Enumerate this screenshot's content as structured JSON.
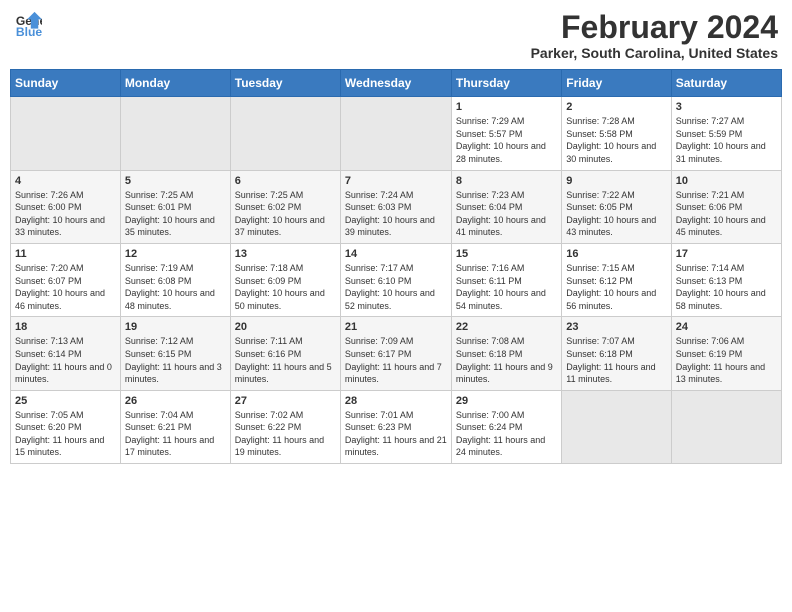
{
  "header": {
    "logo_line1": "General",
    "logo_line2": "Blue",
    "title": "February 2024",
    "subtitle": "Parker, South Carolina, United States"
  },
  "weekdays": [
    "Sunday",
    "Monday",
    "Tuesday",
    "Wednesday",
    "Thursday",
    "Friday",
    "Saturday"
  ],
  "weeks": [
    [
      {
        "day": "",
        "sunrise": "",
        "sunset": "",
        "daylight": "",
        "empty": true
      },
      {
        "day": "",
        "sunrise": "",
        "sunset": "",
        "daylight": "",
        "empty": true
      },
      {
        "day": "",
        "sunrise": "",
        "sunset": "",
        "daylight": "",
        "empty": true
      },
      {
        "day": "",
        "sunrise": "",
        "sunset": "",
        "daylight": "",
        "empty": true
      },
      {
        "day": "1",
        "sunrise": "Sunrise: 7:29 AM",
        "sunset": "Sunset: 5:57 PM",
        "daylight": "Daylight: 10 hours and 28 minutes."
      },
      {
        "day": "2",
        "sunrise": "Sunrise: 7:28 AM",
        "sunset": "Sunset: 5:58 PM",
        "daylight": "Daylight: 10 hours and 30 minutes."
      },
      {
        "day": "3",
        "sunrise": "Sunrise: 7:27 AM",
        "sunset": "Sunset: 5:59 PM",
        "daylight": "Daylight: 10 hours and 31 minutes."
      }
    ],
    [
      {
        "day": "4",
        "sunrise": "Sunrise: 7:26 AM",
        "sunset": "Sunset: 6:00 PM",
        "daylight": "Daylight: 10 hours and 33 minutes."
      },
      {
        "day": "5",
        "sunrise": "Sunrise: 7:25 AM",
        "sunset": "Sunset: 6:01 PM",
        "daylight": "Daylight: 10 hours and 35 minutes."
      },
      {
        "day": "6",
        "sunrise": "Sunrise: 7:25 AM",
        "sunset": "Sunset: 6:02 PM",
        "daylight": "Daylight: 10 hours and 37 minutes."
      },
      {
        "day": "7",
        "sunrise": "Sunrise: 7:24 AM",
        "sunset": "Sunset: 6:03 PM",
        "daylight": "Daylight: 10 hours and 39 minutes."
      },
      {
        "day": "8",
        "sunrise": "Sunrise: 7:23 AM",
        "sunset": "Sunset: 6:04 PM",
        "daylight": "Daylight: 10 hours and 41 minutes."
      },
      {
        "day": "9",
        "sunrise": "Sunrise: 7:22 AM",
        "sunset": "Sunset: 6:05 PM",
        "daylight": "Daylight: 10 hours and 43 minutes."
      },
      {
        "day": "10",
        "sunrise": "Sunrise: 7:21 AM",
        "sunset": "Sunset: 6:06 PM",
        "daylight": "Daylight: 10 hours and 45 minutes."
      }
    ],
    [
      {
        "day": "11",
        "sunrise": "Sunrise: 7:20 AM",
        "sunset": "Sunset: 6:07 PM",
        "daylight": "Daylight: 10 hours and 46 minutes."
      },
      {
        "day": "12",
        "sunrise": "Sunrise: 7:19 AM",
        "sunset": "Sunset: 6:08 PM",
        "daylight": "Daylight: 10 hours and 48 minutes."
      },
      {
        "day": "13",
        "sunrise": "Sunrise: 7:18 AM",
        "sunset": "Sunset: 6:09 PM",
        "daylight": "Daylight: 10 hours and 50 minutes."
      },
      {
        "day": "14",
        "sunrise": "Sunrise: 7:17 AM",
        "sunset": "Sunset: 6:10 PM",
        "daylight": "Daylight: 10 hours and 52 minutes."
      },
      {
        "day": "15",
        "sunrise": "Sunrise: 7:16 AM",
        "sunset": "Sunset: 6:11 PM",
        "daylight": "Daylight: 10 hours and 54 minutes."
      },
      {
        "day": "16",
        "sunrise": "Sunrise: 7:15 AM",
        "sunset": "Sunset: 6:12 PM",
        "daylight": "Daylight: 10 hours and 56 minutes."
      },
      {
        "day": "17",
        "sunrise": "Sunrise: 7:14 AM",
        "sunset": "Sunset: 6:13 PM",
        "daylight": "Daylight: 10 hours and 58 minutes."
      }
    ],
    [
      {
        "day": "18",
        "sunrise": "Sunrise: 7:13 AM",
        "sunset": "Sunset: 6:14 PM",
        "daylight": "Daylight: 11 hours and 0 minutes."
      },
      {
        "day": "19",
        "sunrise": "Sunrise: 7:12 AM",
        "sunset": "Sunset: 6:15 PM",
        "daylight": "Daylight: 11 hours and 3 minutes."
      },
      {
        "day": "20",
        "sunrise": "Sunrise: 7:11 AM",
        "sunset": "Sunset: 6:16 PM",
        "daylight": "Daylight: 11 hours and 5 minutes."
      },
      {
        "day": "21",
        "sunrise": "Sunrise: 7:09 AM",
        "sunset": "Sunset: 6:17 PM",
        "daylight": "Daylight: 11 hours and 7 minutes."
      },
      {
        "day": "22",
        "sunrise": "Sunrise: 7:08 AM",
        "sunset": "Sunset: 6:18 PM",
        "daylight": "Daylight: 11 hours and 9 minutes."
      },
      {
        "day": "23",
        "sunrise": "Sunrise: 7:07 AM",
        "sunset": "Sunset: 6:18 PM",
        "daylight": "Daylight: 11 hours and 11 minutes."
      },
      {
        "day": "24",
        "sunrise": "Sunrise: 7:06 AM",
        "sunset": "Sunset: 6:19 PM",
        "daylight": "Daylight: 11 hours and 13 minutes."
      }
    ],
    [
      {
        "day": "25",
        "sunrise": "Sunrise: 7:05 AM",
        "sunset": "Sunset: 6:20 PM",
        "daylight": "Daylight: 11 hours and 15 minutes."
      },
      {
        "day": "26",
        "sunrise": "Sunrise: 7:04 AM",
        "sunset": "Sunset: 6:21 PM",
        "daylight": "Daylight: 11 hours and 17 minutes."
      },
      {
        "day": "27",
        "sunrise": "Sunrise: 7:02 AM",
        "sunset": "Sunset: 6:22 PM",
        "daylight": "Daylight: 11 hours and 19 minutes."
      },
      {
        "day": "28",
        "sunrise": "Sunrise: 7:01 AM",
        "sunset": "Sunset: 6:23 PM",
        "daylight": "Daylight: 11 hours and 21 minutes."
      },
      {
        "day": "29",
        "sunrise": "Sunrise: 7:00 AM",
        "sunset": "Sunset: 6:24 PM",
        "daylight": "Daylight: 11 hours and 24 minutes."
      },
      {
        "day": "",
        "sunrise": "",
        "sunset": "",
        "daylight": "",
        "empty": true
      },
      {
        "day": "",
        "sunrise": "",
        "sunset": "",
        "daylight": "",
        "empty": true
      }
    ]
  ]
}
